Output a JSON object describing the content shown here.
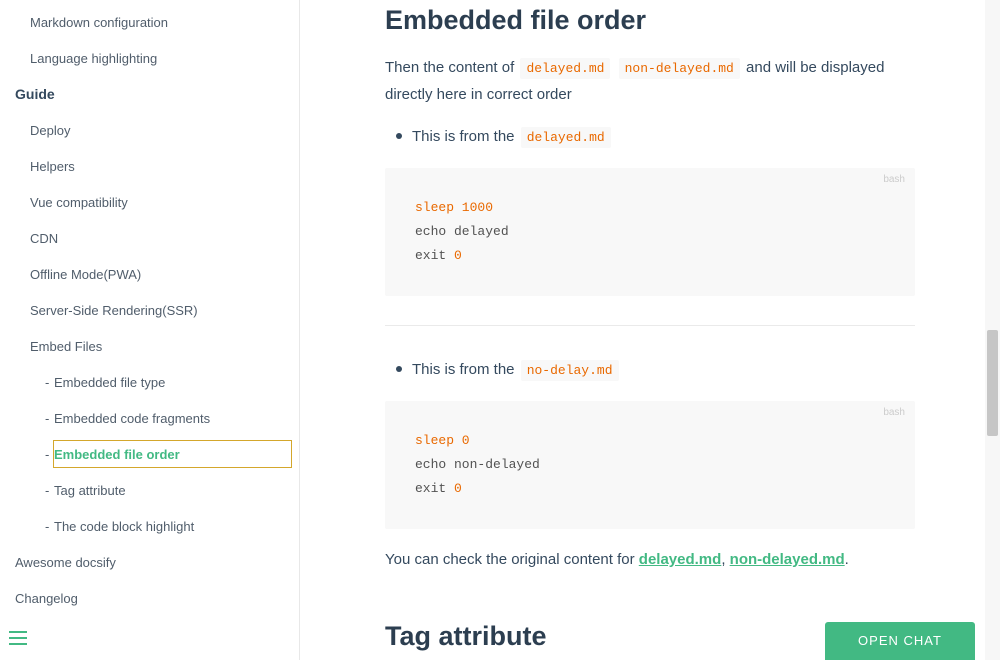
{
  "sidebar": {
    "items": [
      {
        "label": "Markdown configuration"
      },
      {
        "label": "Language highlighting"
      },
      {
        "label": "Guide"
      },
      {
        "label": "Deploy"
      },
      {
        "label": "Helpers"
      },
      {
        "label": "Vue compatibility"
      },
      {
        "label": "CDN"
      },
      {
        "label": "Offline Mode(PWA)"
      },
      {
        "label": "Server-Side Rendering(SSR)"
      },
      {
        "label": "Embed Files"
      },
      {
        "label": "Embedded file type"
      },
      {
        "label": "Embedded code fragments"
      },
      {
        "label": "Embedded file order"
      },
      {
        "label": "Tag attribute"
      },
      {
        "label": "The code block highlight"
      },
      {
        "label": "Awesome docsify"
      },
      {
        "label": "Changelog"
      }
    ],
    "dash": "-"
  },
  "content": {
    "heading": "Embedded file order",
    "intro": {
      "pre": "Then the content of",
      "code1": "delayed.md",
      "code2": "non-delayed.md",
      "line1_post": "and will be displayed",
      "line2": "directly here in correct order"
    },
    "bullet1": {
      "text": "This is from the",
      "code": "delayed.md"
    },
    "code1": {
      "lang": "bash",
      "l1_kw": "sleep 1000",
      "l2": "echo delayed",
      "l3_pre": "exit ",
      "l3_num": "0"
    },
    "bullet2": {
      "text": "This is from the",
      "code": "no-delay.md"
    },
    "code2": {
      "lang": "bash",
      "l1_kw": "sleep 0",
      "l2": "echo non-delayed",
      "l3_pre": "exit ",
      "l3_num": "0"
    },
    "check": {
      "pre": "You can check the original content for",
      "link1": "delayed.md",
      "sep": ",",
      "link2": "non-delayed.md",
      "post": "."
    },
    "heading2": "Tag attribute"
  },
  "chat": {
    "label": "OPEN CHAT"
  },
  "colors": {
    "accent": "#42b983",
    "code_keyword": "#e96900"
  }
}
